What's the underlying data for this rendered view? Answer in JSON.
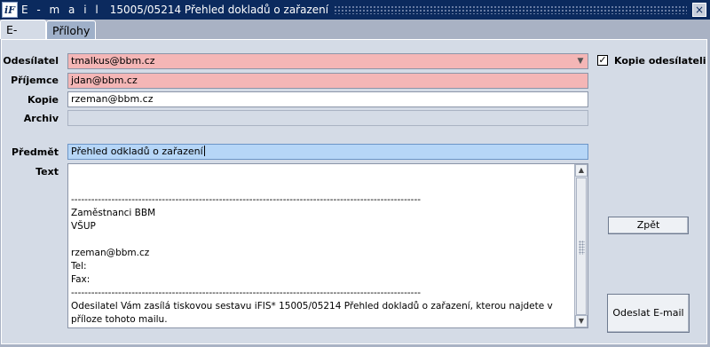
{
  "window": {
    "title_prefix": "E - m a i l",
    "title": "15005/05214 Přehled dokladů o zařazení",
    "app_icon": "iF"
  },
  "tabs": [
    {
      "label": "E-mail",
      "active": true
    },
    {
      "label": "Přílohy",
      "active": false
    }
  ],
  "form": {
    "odesilatel": {
      "label": "Odesílatel",
      "value": "tmalkus@bbm.cz"
    },
    "prijemce": {
      "label": "Příjemce",
      "value": "jdan@bbm.cz"
    },
    "kopie": {
      "label": "Kopie",
      "value": "rzeman@bbm.cz"
    },
    "archiv": {
      "label": "Archiv",
      "value": ""
    },
    "predmet": {
      "label": "Předmět",
      "value": "Přehled odkladů o zařazení"
    },
    "text": {
      "label": "Text",
      "lines": [
        "",
        "",
        "--------------------------------------------------------------------------------------------------------",
        "Zaměstnanci BBM",
        "VŠUP",
        "",
        "rzeman@bbm.cz",
        "Tel:",
        "Fax:",
        "--------------------------------------------------------------------------------------------------------",
        "Odesilatel Vám zasílá tiskovou sestavu iFIS* 15005/05214 Přehled dokladů o zařazení, kterou najdete v příloze tohoto mailu."
      ]
    },
    "kopie_odesilateli": {
      "label": "Kopie odesílateli",
      "checked": true
    }
  },
  "buttons": {
    "zpet": "Zpět",
    "odeslat": "Odeslat E-mail"
  },
  "colors": {
    "title_bar": "#0b2a5e",
    "required_field": "#f4b6b6",
    "focused_field": "#b6d6f7",
    "panel": "#d4dbe6"
  }
}
